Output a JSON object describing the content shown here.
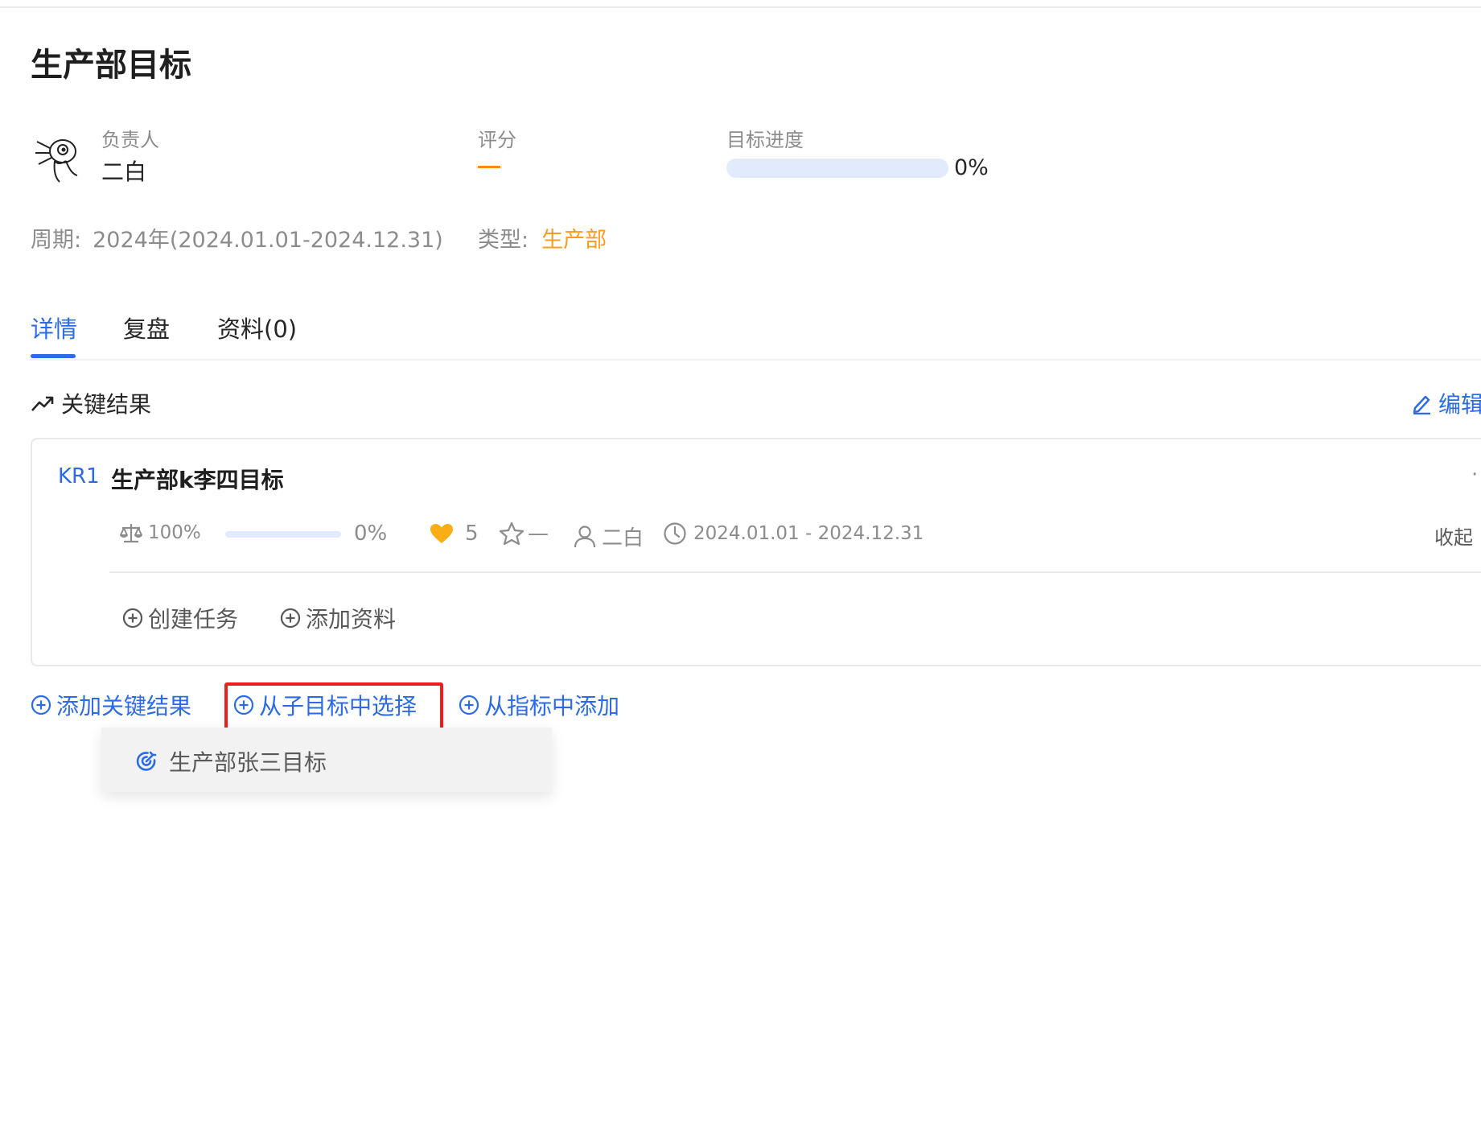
{
  "header": {
    "title": "生产部目标"
  },
  "meta": {
    "owner_label": "负责人",
    "owner_name": "二白",
    "score_label": "评分",
    "progress_label": "目标进度",
    "progress_text": "0%",
    "progress_value": 0,
    "period_label": "周期:",
    "period_value": "2024年(2024.01.01-2024.12.31)",
    "type_label": "类型:",
    "type_value": "生产部"
  },
  "tabs": [
    {
      "label": "详情",
      "active": true
    },
    {
      "label": "复盘",
      "active": false
    },
    {
      "label": "资料(0)",
      "active": false
    }
  ],
  "key_results": {
    "section_title": "关键结果",
    "edit_label": "编辑",
    "items": [
      {
        "tag": "KR1",
        "title": "生产部k李四目标",
        "more": "·",
        "weight": "100%",
        "progress_text": "0%",
        "progress_value": 0,
        "confidence": "5",
        "score": "—",
        "owner": "二白",
        "date_range": "2024.01.01 - 2024.12.31",
        "collapse_label": "收起",
        "actions": {
          "create_task": "创建任务",
          "add_material": "添加资料"
        }
      }
    ]
  },
  "bottom_actions": {
    "add_kr": "添加关键结果",
    "select_from_sub": "从子目标中选择",
    "add_from_metric": "从指标中添加"
  },
  "dropdown": {
    "items": [
      {
        "label": "生产部张三目标"
      }
    ]
  },
  "colors": {
    "accent": "#2b6ae8",
    "type_orange": "#fa9c1e",
    "score_dash": "#fa8c16",
    "heart": "#faad14",
    "highlight_red": "#ef1d1d"
  }
}
